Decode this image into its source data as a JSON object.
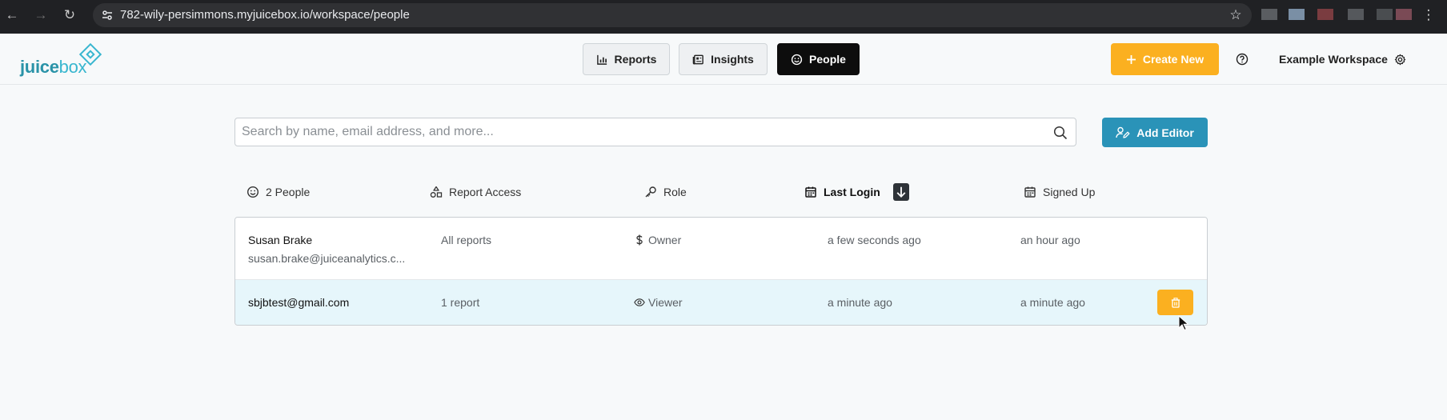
{
  "browser": {
    "url": "782-wily-persimmons.myjuicebox.io/workspace/people"
  },
  "app": {
    "logo_prefix": "juice",
    "logo_suffix": "box",
    "brand_color": "#2a93a8",
    "accent_color": "#fbb020",
    "primary_color": "#2a93b8"
  },
  "nav": {
    "tabs": [
      {
        "label": "Reports",
        "icon": "bar-chart-icon",
        "active": false
      },
      {
        "label": "Insights",
        "icon": "newspaper-icon",
        "active": false
      },
      {
        "label": "People",
        "icon": "smile-icon",
        "active": true
      }
    ],
    "create_label": "Create New",
    "workspace_label": "Example Workspace"
  },
  "search": {
    "placeholder": "Search by name, email address, and more...",
    "value": ""
  },
  "add_editor_label": "Add Editor",
  "columns": {
    "people": "2 People",
    "report_access": "Report Access",
    "role": "Role",
    "last_login": "Last Login",
    "signed_up": "Signed Up"
  },
  "rows": [
    {
      "name": "Susan Brake",
      "email": "susan.brake@juiceanalytics.c...",
      "access": "All reports",
      "role": "Owner",
      "role_icon": "dollar-icon",
      "last_login": "a few seconds ago",
      "signed_up": "an hour ago"
    },
    {
      "name": "sbjbtest@gmail.com",
      "access": "1 report",
      "role": "Viewer",
      "role_icon": "eye-icon",
      "last_login": "a minute ago",
      "signed_up": "a minute ago"
    }
  ]
}
